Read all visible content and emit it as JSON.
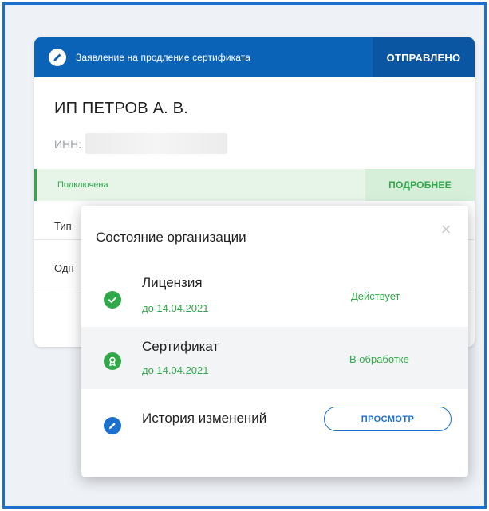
{
  "card": {
    "header_title": "Заявление на продление сертификата",
    "header_status": "ОТПРАВЛЕНО",
    "org_name": "ИП ПЕТРОВ А. В.",
    "inn_label": "ИНН:",
    "status_text": "Подключена",
    "more_label": "ПОДРОБНЕЕ",
    "row1_text": "Тип",
    "row2_text": "Одн"
  },
  "popup": {
    "title": "Состояние организации",
    "close_glyph": "×",
    "items": [
      {
        "name": "Лицензия",
        "date": "до 14.04.2021",
        "state": "Действует"
      },
      {
        "name": "Сертификат",
        "date": "до 14.04.2021",
        "state": "В обработке"
      },
      {
        "name": "История изменений",
        "button_label": "ПРОСМОТР"
      }
    ]
  },
  "colors": {
    "primary_blue": "#0b63b8",
    "success_green": "#31a84a",
    "frame_border": "#1a6fcf"
  }
}
